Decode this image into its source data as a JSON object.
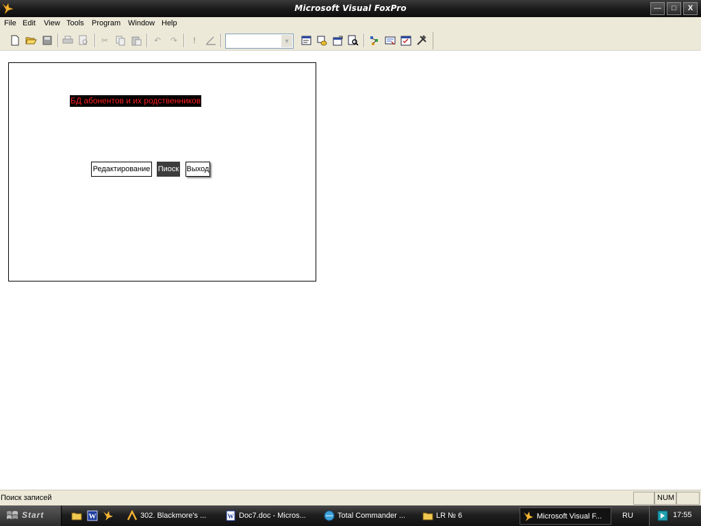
{
  "window": {
    "title": "Microsoft Visual FoxPro",
    "min_symbol": "—",
    "max_symbol": "□",
    "close_symbol": "X"
  },
  "menu": [
    "File",
    "Edit",
    "View",
    "Tools",
    "Program",
    "Window",
    "Help"
  ],
  "toolbar": {
    "combo_value": "",
    "combo_arrow": "▼"
  },
  "form": {
    "heading": "БД абонентов и их родственников",
    "edit_label": "Редактирование",
    "search_label": "Пиоск",
    "exit_label": "Выход"
  },
  "status": {
    "message": "Поиск записей",
    "num": "NUM"
  },
  "taskbar": {
    "start_label": "Start",
    "tasks": [
      "302. Blackmore's ...",
      "Doc7.doc - Micros...",
      "Total Commander ...",
      "LR № 6",
      "Microsoft Visual F..."
    ],
    "language": "RU",
    "clock": "17:55"
  },
  "colors": {
    "heading_text": "#ff1f1f",
    "heading_bg": "#000000",
    "search_button_bg": "#3c3c3c"
  }
}
